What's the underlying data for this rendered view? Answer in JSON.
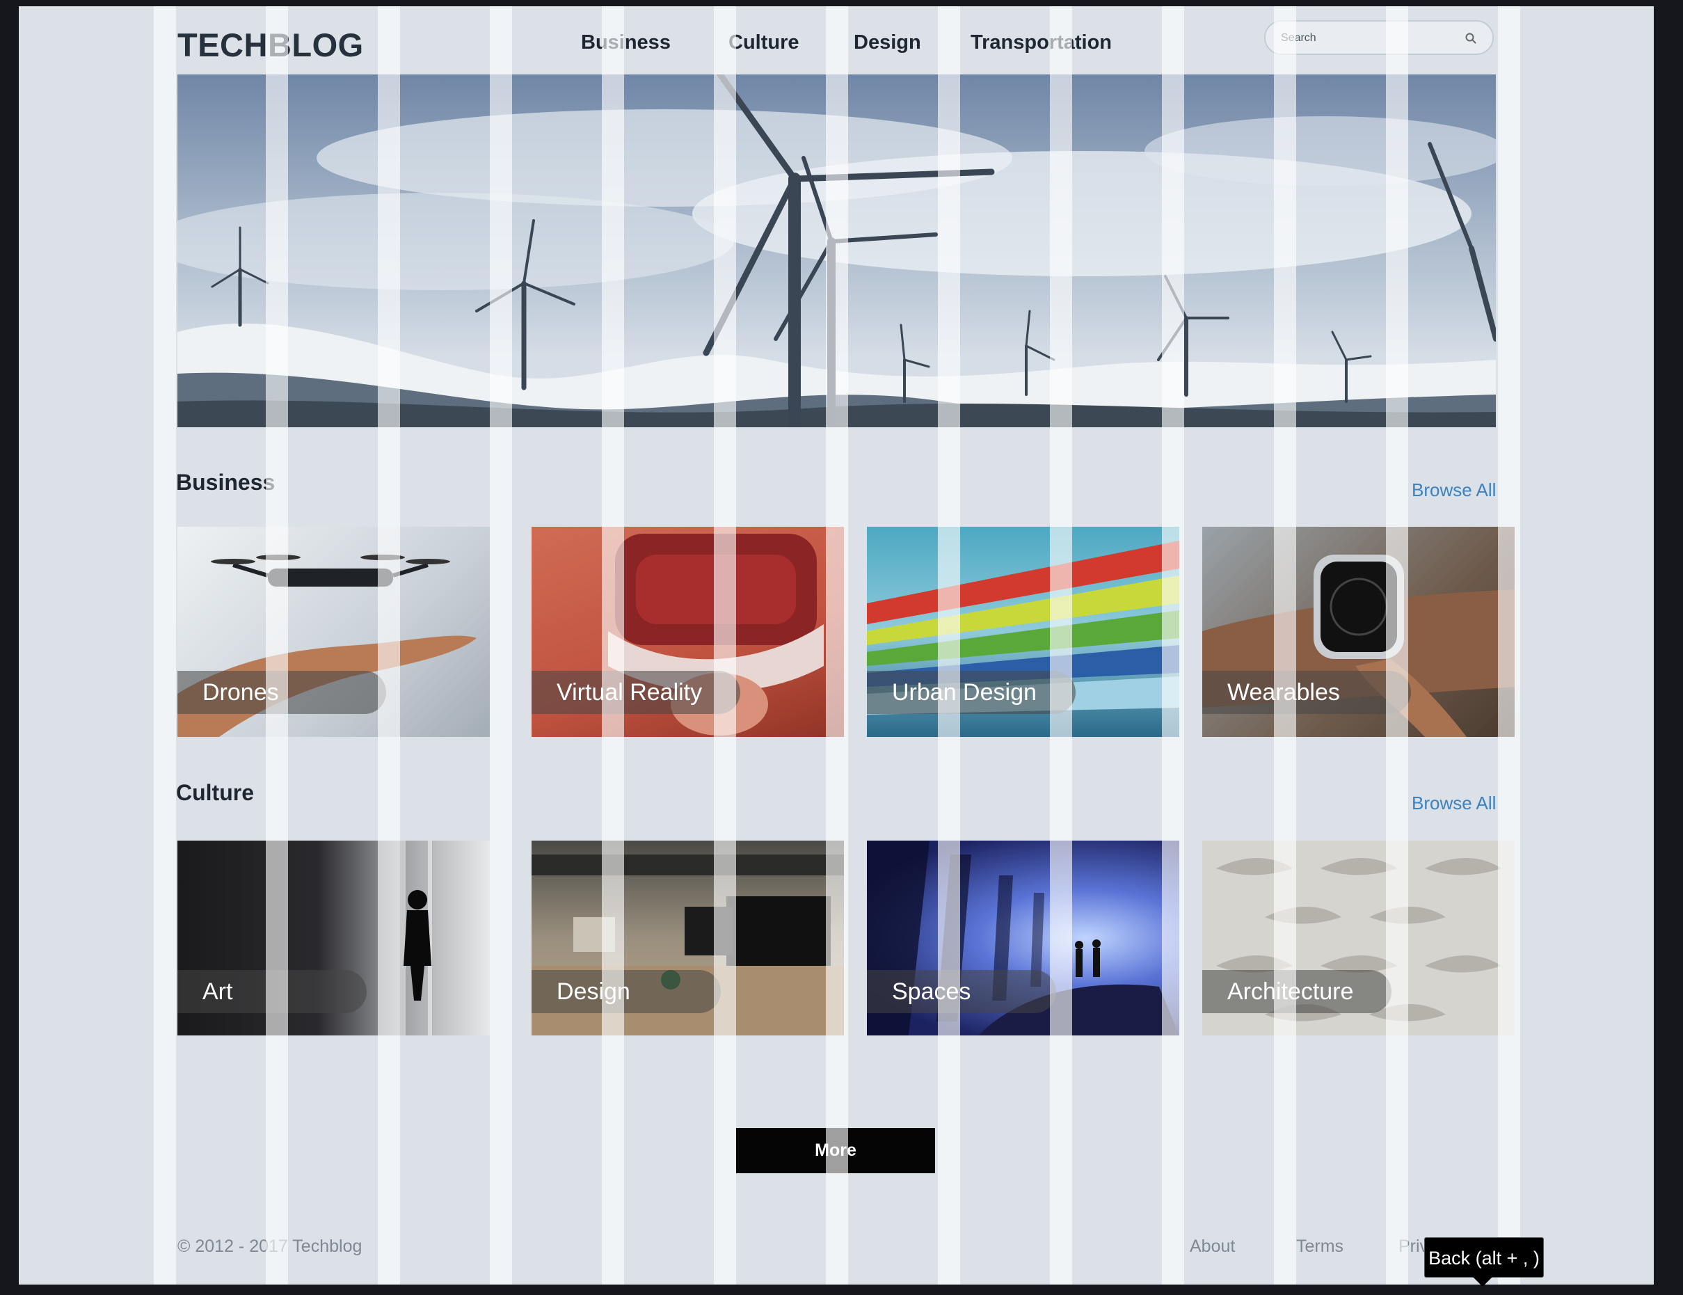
{
  "site": {
    "logo": "TECHBLOG"
  },
  "nav": [
    {
      "label": "Business"
    },
    {
      "label": "Culture"
    },
    {
      "label": "Design"
    },
    {
      "label": "Transportation"
    }
  ],
  "search": {
    "placeholder": "Search",
    "icon": "search-icon"
  },
  "hero": {
    "image": "wind-turbines-on-snowy-hills"
  },
  "sections": [
    {
      "title": "Business",
      "browse_label": "Browse All",
      "cards": [
        {
          "label": "Drones",
          "image": "drone-over-hand"
        },
        {
          "label": "Virtual Reality",
          "image": "person-in-vr-headset"
        },
        {
          "label": "Urban Design",
          "image": "train-motion-blur"
        },
        {
          "label": "Wearables",
          "image": "smartwatch-on-wrist"
        }
      ]
    },
    {
      "title": "Culture",
      "browse_label": "Browse All",
      "cards": [
        {
          "label": "Art",
          "image": "silhouette-in-gallery"
        },
        {
          "label": "Design",
          "image": "office-workspace"
        },
        {
          "label": "Spaces",
          "image": "blue-lit-tunnel"
        },
        {
          "label": "Architecture",
          "image": "concrete-facade-pattern"
        }
      ]
    }
  ],
  "more_label": "More",
  "footer": {
    "copyright": "© 2012 - 2017 Techblog",
    "links": [
      "About",
      "Terms",
      "Priva"
    ]
  },
  "tooltip": "Back (alt + , )"
}
